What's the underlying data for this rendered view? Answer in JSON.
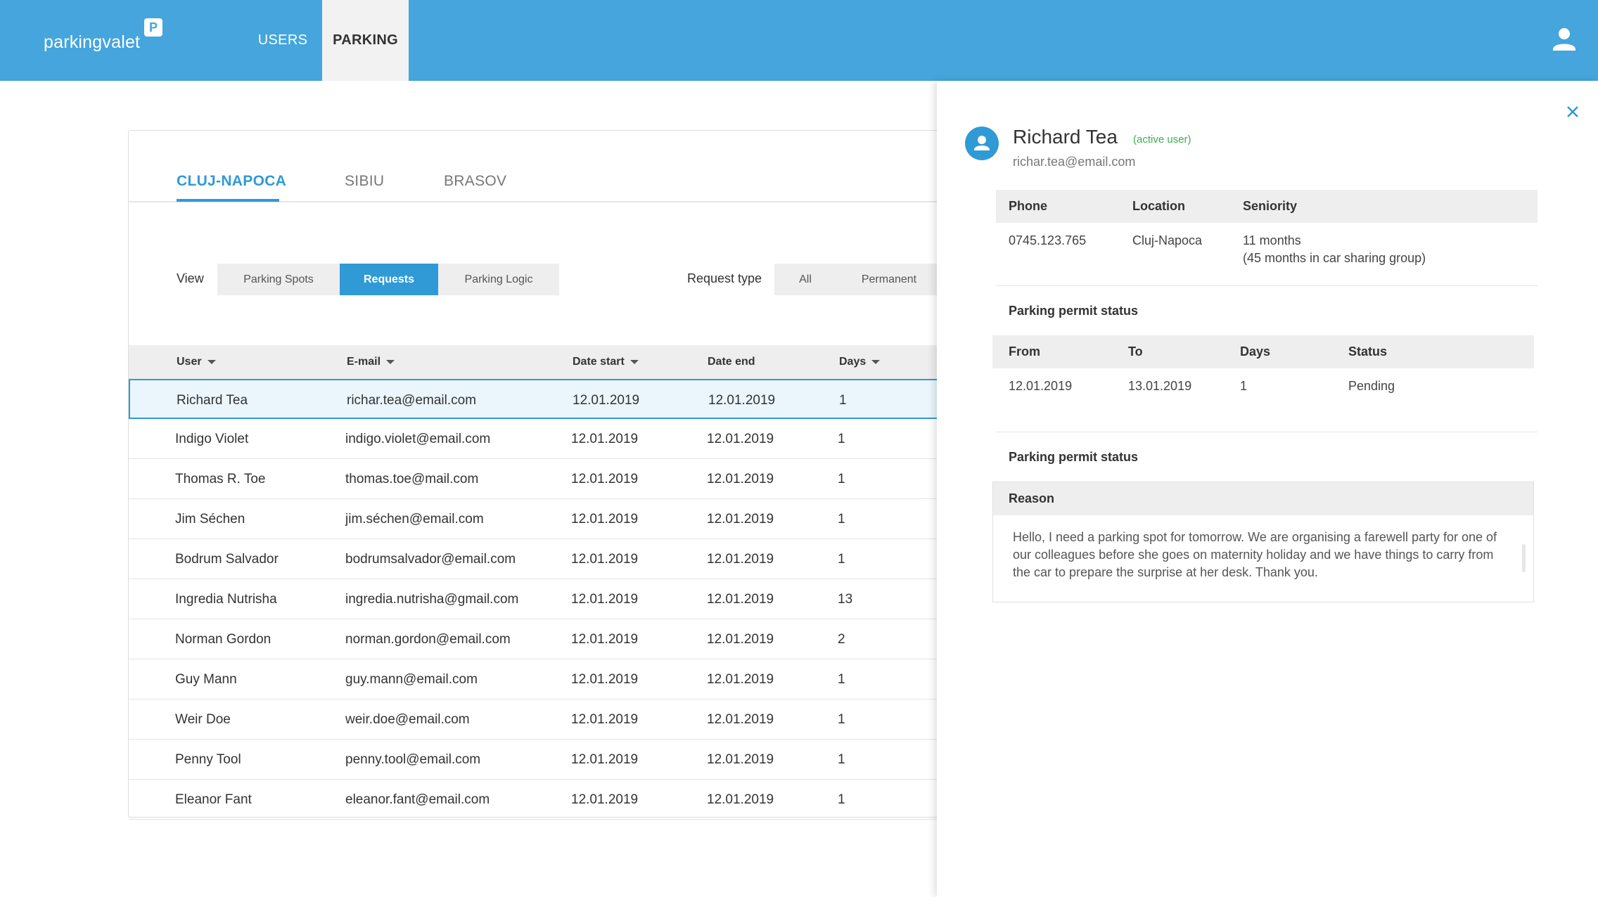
{
  "header": {
    "logo_text": "parkingvalet",
    "logo_badge": "P",
    "nav": [
      {
        "label": "USERS",
        "active": false
      },
      {
        "label": "PARKING",
        "active": true
      }
    ],
    "user_icon": "user-icon",
    "accent_color": "#45a5dc"
  },
  "cities": {
    "tabs": [
      "CLUJ-NAPOCA",
      "SIBIU",
      "BRASOV"
    ],
    "active": "CLUJ-NAPOCA"
  },
  "filters": {
    "view_label": "View",
    "views": [
      "Parking Spots",
      "Requests",
      "Parking Logic"
    ],
    "active_view": "Requests",
    "request_type_label": "Request type",
    "request_types": [
      "All",
      "Permanent"
    ]
  },
  "table": {
    "columns": [
      "User",
      "E-mail",
      "Date start",
      "Date end",
      "Days"
    ],
    "sortable": [
      "User",
      "E-mail",
      "Date start",
      "Days"
    ],
    "rows": [
      {
        "user": "Richard Tea",
        "email": "richar.tea@email.com",
        "start": "12.01.2019",
        "end": "12.01.2019",
        "days": "1"
      },
      {
        "user": "Indigo Violet",
        "email": "indigo.violet@email.com",
        "start": "12.01.2019",
        "end": "12.01.2019",
        "days": "1"
      },
      {
        "user": "Thomas R. Toe",
        "email": "thomas.toe@mail.com",
        "start": "12.01.2019",
        "end": "12.01.2019",
        "days": "1"
      },
      {
        "user": "Jim Séchen",
        "email": "jim.séchen@email.com",
        "start": "12.01.2019",
        "end": "12.01.2019",
        "days": "1"
      },
      {
        "user": "Bodrum Salvador",
        "email": "bodrumsalvador@email.com",
        "start": "12.01.2019",
        "end": "12.01.2019",
        "days": "1"
      },
      {
        "user": "Ingredia Nutrisha",
        "email": "ingredia.nutrisha@gmail.com",
        "start": "12.01.2019",
        "end": "12.01.2019",
        "days": "13"
      },
      {
        "user": "Norman Gordon",
        "email": "norman.gordon@email.com",
        "start": "12.01.2019",
        "end": "12.01.2019",
        "days": "2"
      },
      {
        "user": "Guy Mann",
        "email": "guy.mann@email.com",
        "start": "12.01.2019",
        "end": "12.01.2019",
        "days": "1"
      },
      {
        "user": "Weir Doe",
        "email": "weir.doe@email.com",
        "start": "12.01.2019",
        "end": "12.01.2019",
        "days": "1"
      },
      {
        "user": "Penny Tool",
        "email": "penny.tool@email.com",
        "start": "12.01.2019",
        "end": "12.01.2019",
        "days": "1"
      },
      {
        "user": "Eleanor Fant",
        "email": "eleanor.fant@email.com",
        "start": "12.01.2019",
        "end": "12.01.2019",
        "days": "1"
      }
    ],
    "selected_index": 0
  },
  "panel": {
    "name": "Richard Tea",
    "status": "(active user)",
    "status_color": "#3ab04a",
    "email": "richar.tea@email.com",
    "info": {
      "headers": [
        "Phone",
        "Location",
        "Seniority"
      ],
      "phone": "0745.123.765",
      "location": "Cluj-Napoca",
      "seniority": "11 months",
      "seniority_note": "(45 months in car sharing group)"
    },
    "permit_title": "Parking permit status",
    "permit": {
      "headers": [
        "From",
        "To",
        "Days",
        "Status"
      ],
      "from": "12.01.2019",
      "to": "13.01.2019",
      "days": "1",
      "status": "Pending"
    },
    "permit_title_2": "Parking permit status",
    "reason_label": "Reason",
    "reason_text": "Hello, I need a parking spot for tomorrow. We are organising a farewell party for one of our colleagues before she goes on maternity holiday and we have things to carry from the car to prepare the surprise at her desk. Thank you."
  }
}
